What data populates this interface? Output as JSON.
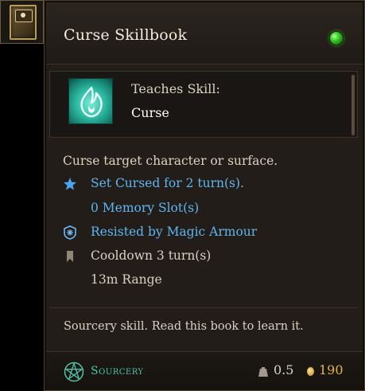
{
  "item": {
    "icon": "skillbook-icon",
    "title": "Curse Skillbook",
    "rarity_gem_color": "#3bd12a"
  },
  "skill": {
    "icon": "curse-flame-icon",
    "teaches_label": "Teaches Skill:",
    "name": "Curse"
  },
  "description": "Curse target character or surface.",
  "properties": [
    {
      "icon": "star-icon",
      "text": "Set Cursed for 2 turn(s).",
      "color": "#5fb6f0"
    },
    {
      "icon": "",
      "text": "0 Memory Slot(s)",
      "color": "#5fb6f0"
    },
    {
      "icon": "magic-armour-icon",
      "text": "Resisted by Magic Armour",
      "color": "#5fb6f0"
    },
    {
      "icon": "bookmark-icon",
      "text": "Cooldown  3 turn(s)",
      "color": "#d9d2c5"
    },
    {
      "icon": "",
      "text": "13m  Range",
      "color": "#d9d2c5"
    }
  ],
  "footer": "Sourcery skill. Read this book to learn it.",
  "bottom": {
    "school_icon": "pentagram-icon",
    "school": "Sourcery",
    "weight": "0.5",
    "gold": "190",
    "weight_icon": "weight-icon",
    "gold_icon": "gold-coin-icon"
  }
}
